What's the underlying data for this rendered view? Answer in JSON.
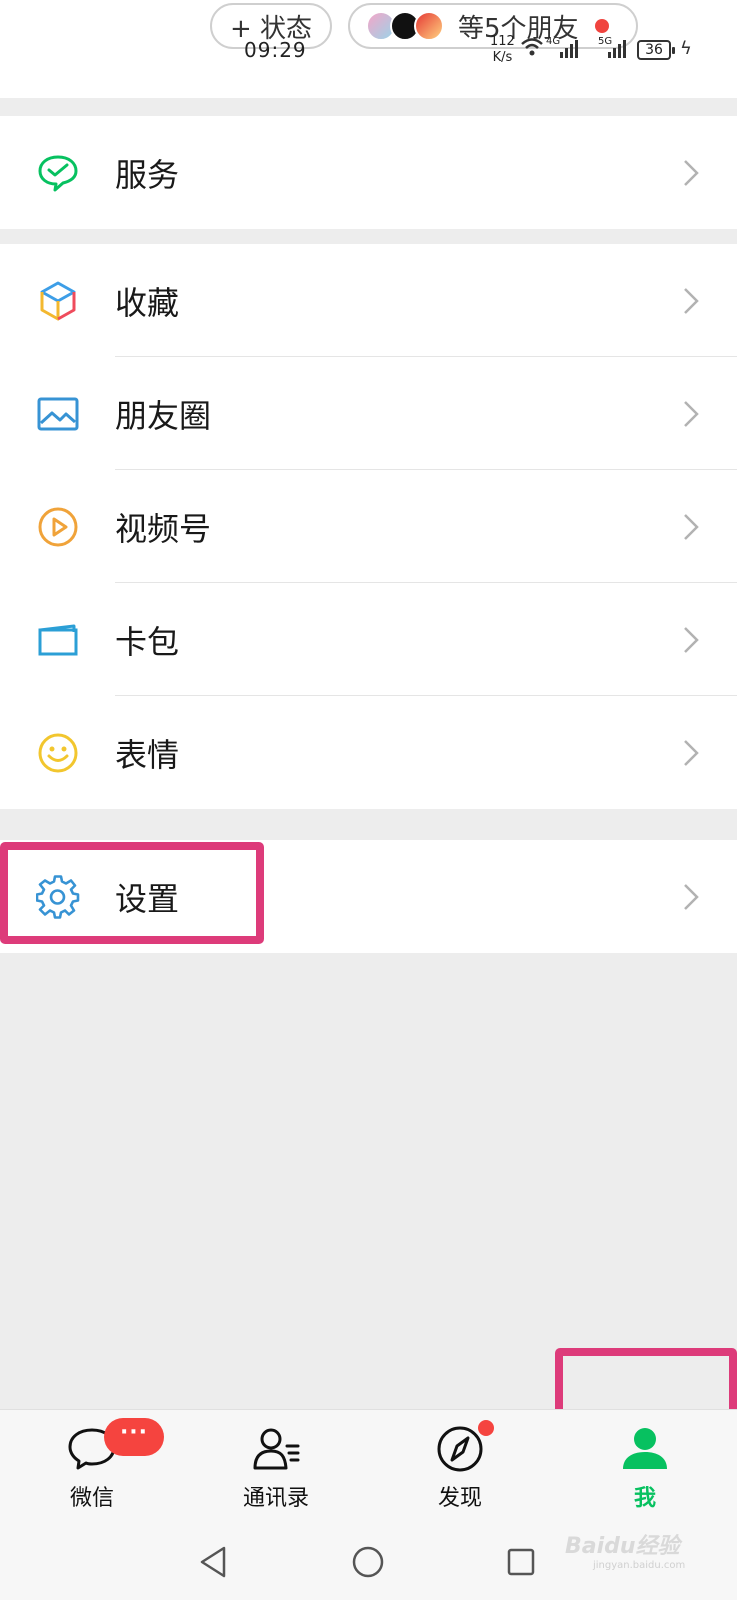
{
  "status_bar": {
    "add_status_label": "+ 状态",
    "friends_label": "等5个朋友",
    "time": "09:29",
    "net_speed_value": "112",
    "net_speed_unit": "K/s",
    "net_4g": "4G",
    "net_5g": "5G",
    "battery": "36"
  },
  "menu": {
    "services": "服务",
    "favorites": "收藏",
    "moments": "朋友圈",
    "channels": "视频号",
    "cards": "卡包",
    "stickers": "表情",
    "settings": "设置"
  },
  "tabs": {
    "chats": "微信",
    "chats_badge": "···",
    "contacts": "通讯录",
    "discover": "发现",
    "me": "我"
  },
  "watermark": {
    "brand": "Baidu经验",
    "url": "jingyan.baidu.com"
  },
  "colors": {
    "accent_green": "#07c160",
    "highlight_pink": "#dd3b7a",
    "badge_red": "#f5443f",
    "background": "#ededed"
  }
}
